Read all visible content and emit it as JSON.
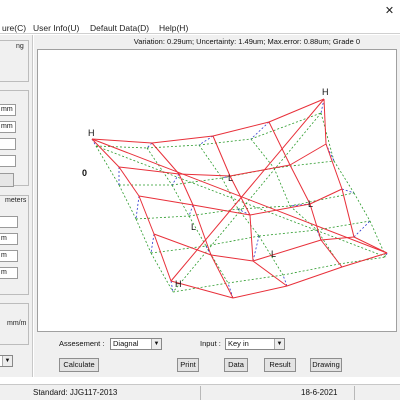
{
  "menu": {
    "items": [
      {
        "label": "ure(C)",
        "name": "menu-measure"
      },
      {
        "label": "User Info(U)",
        "name": "menu-user-info"
      },
      {
        "label": "Default Data(D)",
        "name": "menu-default-data"
      },
      {
        "label": "Help(H)",
        "name": "menu-help"
      }
    ],
    "close_glyph": "✕"
  },
  "left_panel": {
    "frag_ng": "ng",
    "unit_mm_1": "mm",
    "unit_mm_2": "mm",
    "frag_meters": "meters",
    "unit_m_1": "m",
    "unit_m_2": "m",
    "unit_m_3": "m",
    "unit_mm_per_m": "mm/m"
  },
  "status_line": "Variation: 0.29um;  Uncertainty: 1.49um;  Max.error: 0.88um;  Grade 0",
  "plot": {
    "grade_label": "0",
    "corner_label_h": "H",
    "corner_label_l": "L",
    "colors": {
      "measured_grid": "#e8303a",
      "reference_grid": "#2a9a2a",
      "verticals": "#2a36d0"
    }
  },
  "controls": {
    "assessment_label": "Assesement :",
    "assessment_value": "Diagnal",
    "input_label": "Input :",
    "input_value": "Key in",
    "buttons": {
      "calculate": "Calculate",
      "print": "Print",
      "data": "Data",
      "result": "Result",
      "drawing": "Drawing"
    }
  },
  "statusbar": {
    "standard": "Standard:  JJG117-2013",
    "date": "18-6-2021"
  }
}
